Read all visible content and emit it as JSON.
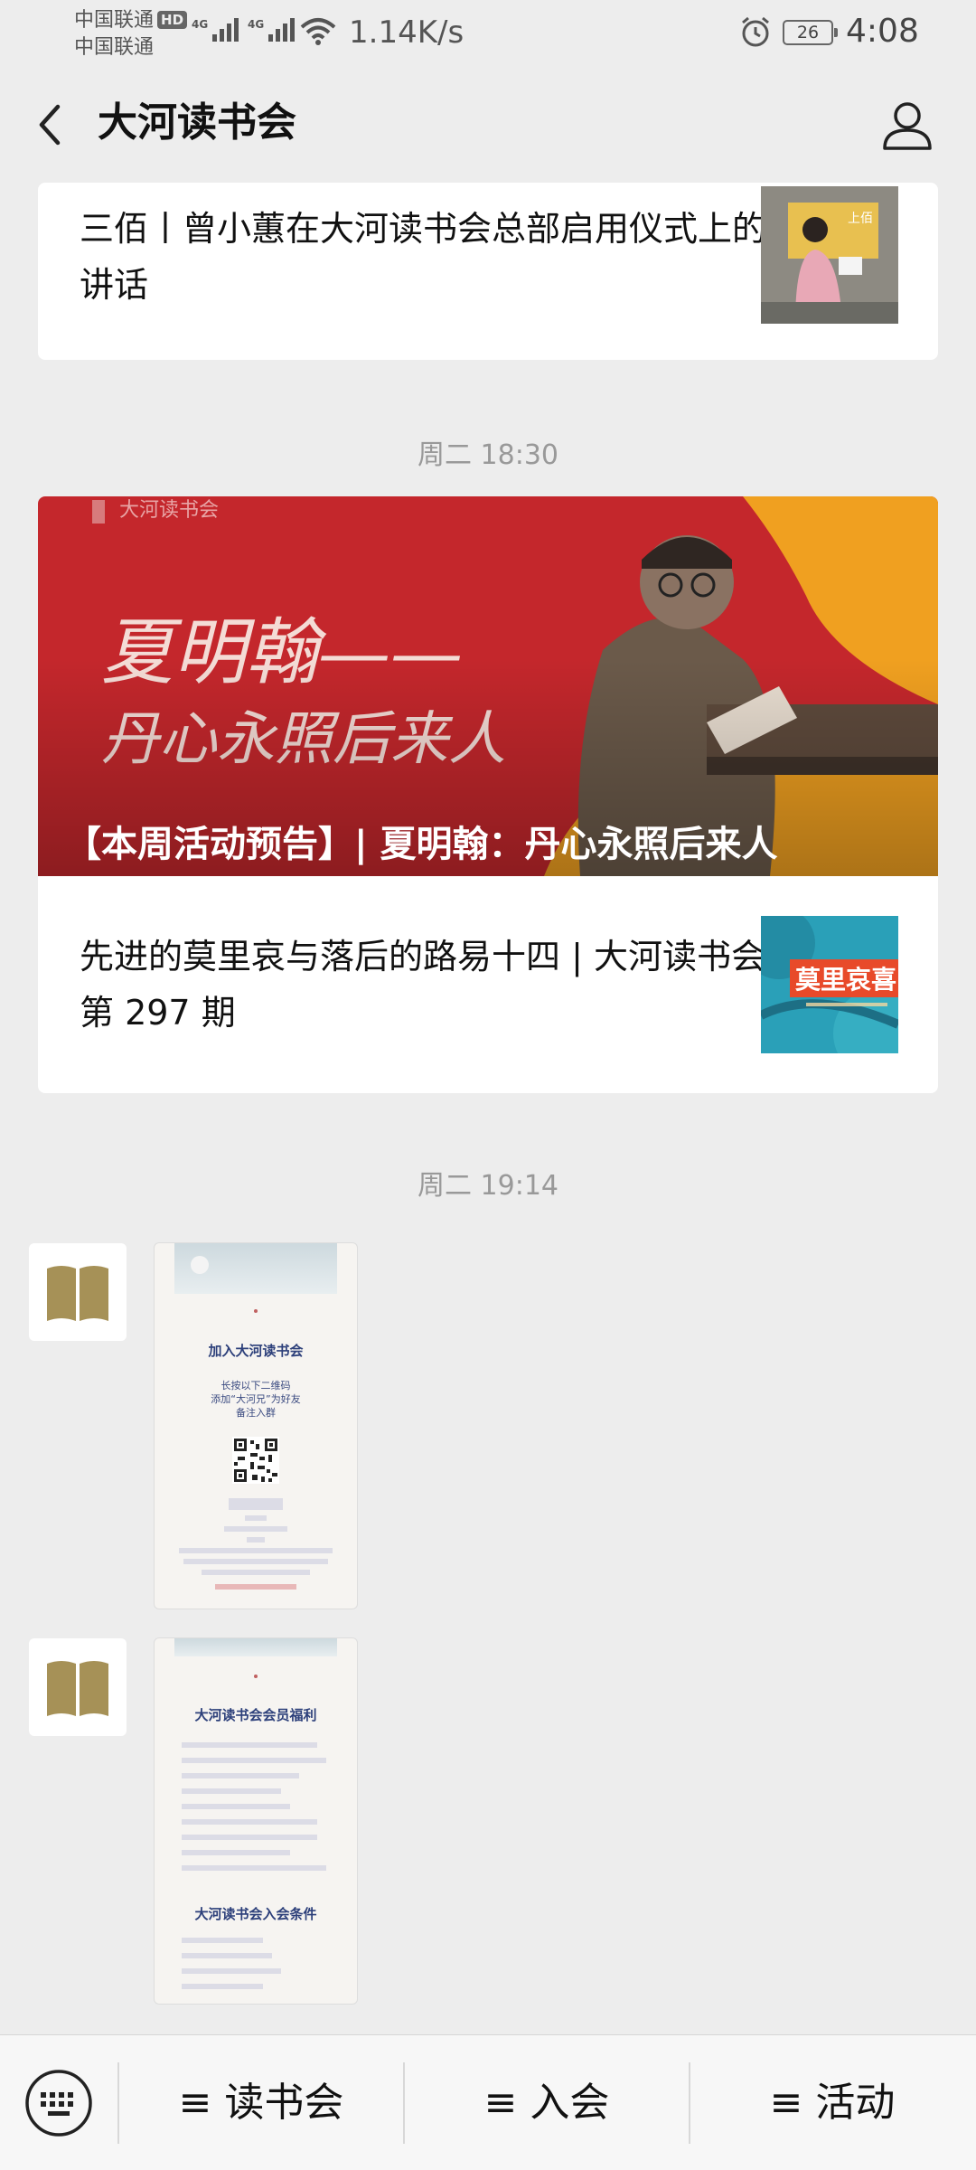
{
  "status_bar": {
    "carrier1": "中国联通",
    "carrier1_badge": "HD",
    "carrier2": "中国联通",
    "network1": "4G",
    "network2": "4G",
    "speed": "1.14K/s",
    "battery": "26",
    "time": "4:08"
  },
  "header": {
    "title": "大河读书会",
    "back_icon": "chevron-left-icon",
    "profile_icon": "person-icon"
  },
  "messages": [
    {
      "type": "article-item",
      "title": "三佰丨曾小蕙在大河读书会总部启用仪式上的讲话"
    },
    {
      "time": "周二 18:30",
      "banner_title": "【本周活动预告】| 夏明翰：丹心永照后来人",
      "banner_art_text": "夏明翰——丹心永照后来人",
      "banner_logo": "大河读书会",
      "item_title": "先进的莫里哀与落后的路易十四 | 大河读书会第 297 期",
      "item_thumb_text": "莫里哀喜"
    },
    {
      "time": "周二 19:14",
      "poster1": {
        "title": "加入大河读书会",
        "lines": [
          "长按以下二维码",
          "添加“大河兄”为好友",
          "备注入群"
        ]
      },
      "poster2": {
        "title": "大河读书会会员福利",
        "subtitle": "大河读书会入会条件"
      }
    }
  ],
  "bottom_menu": {
    "keyboard_icon": "keyboard-icon",
    "items": [
      "≡ 读书会",
      "≡ 入会",
      "≡ 活动"
    ]
  }
}
